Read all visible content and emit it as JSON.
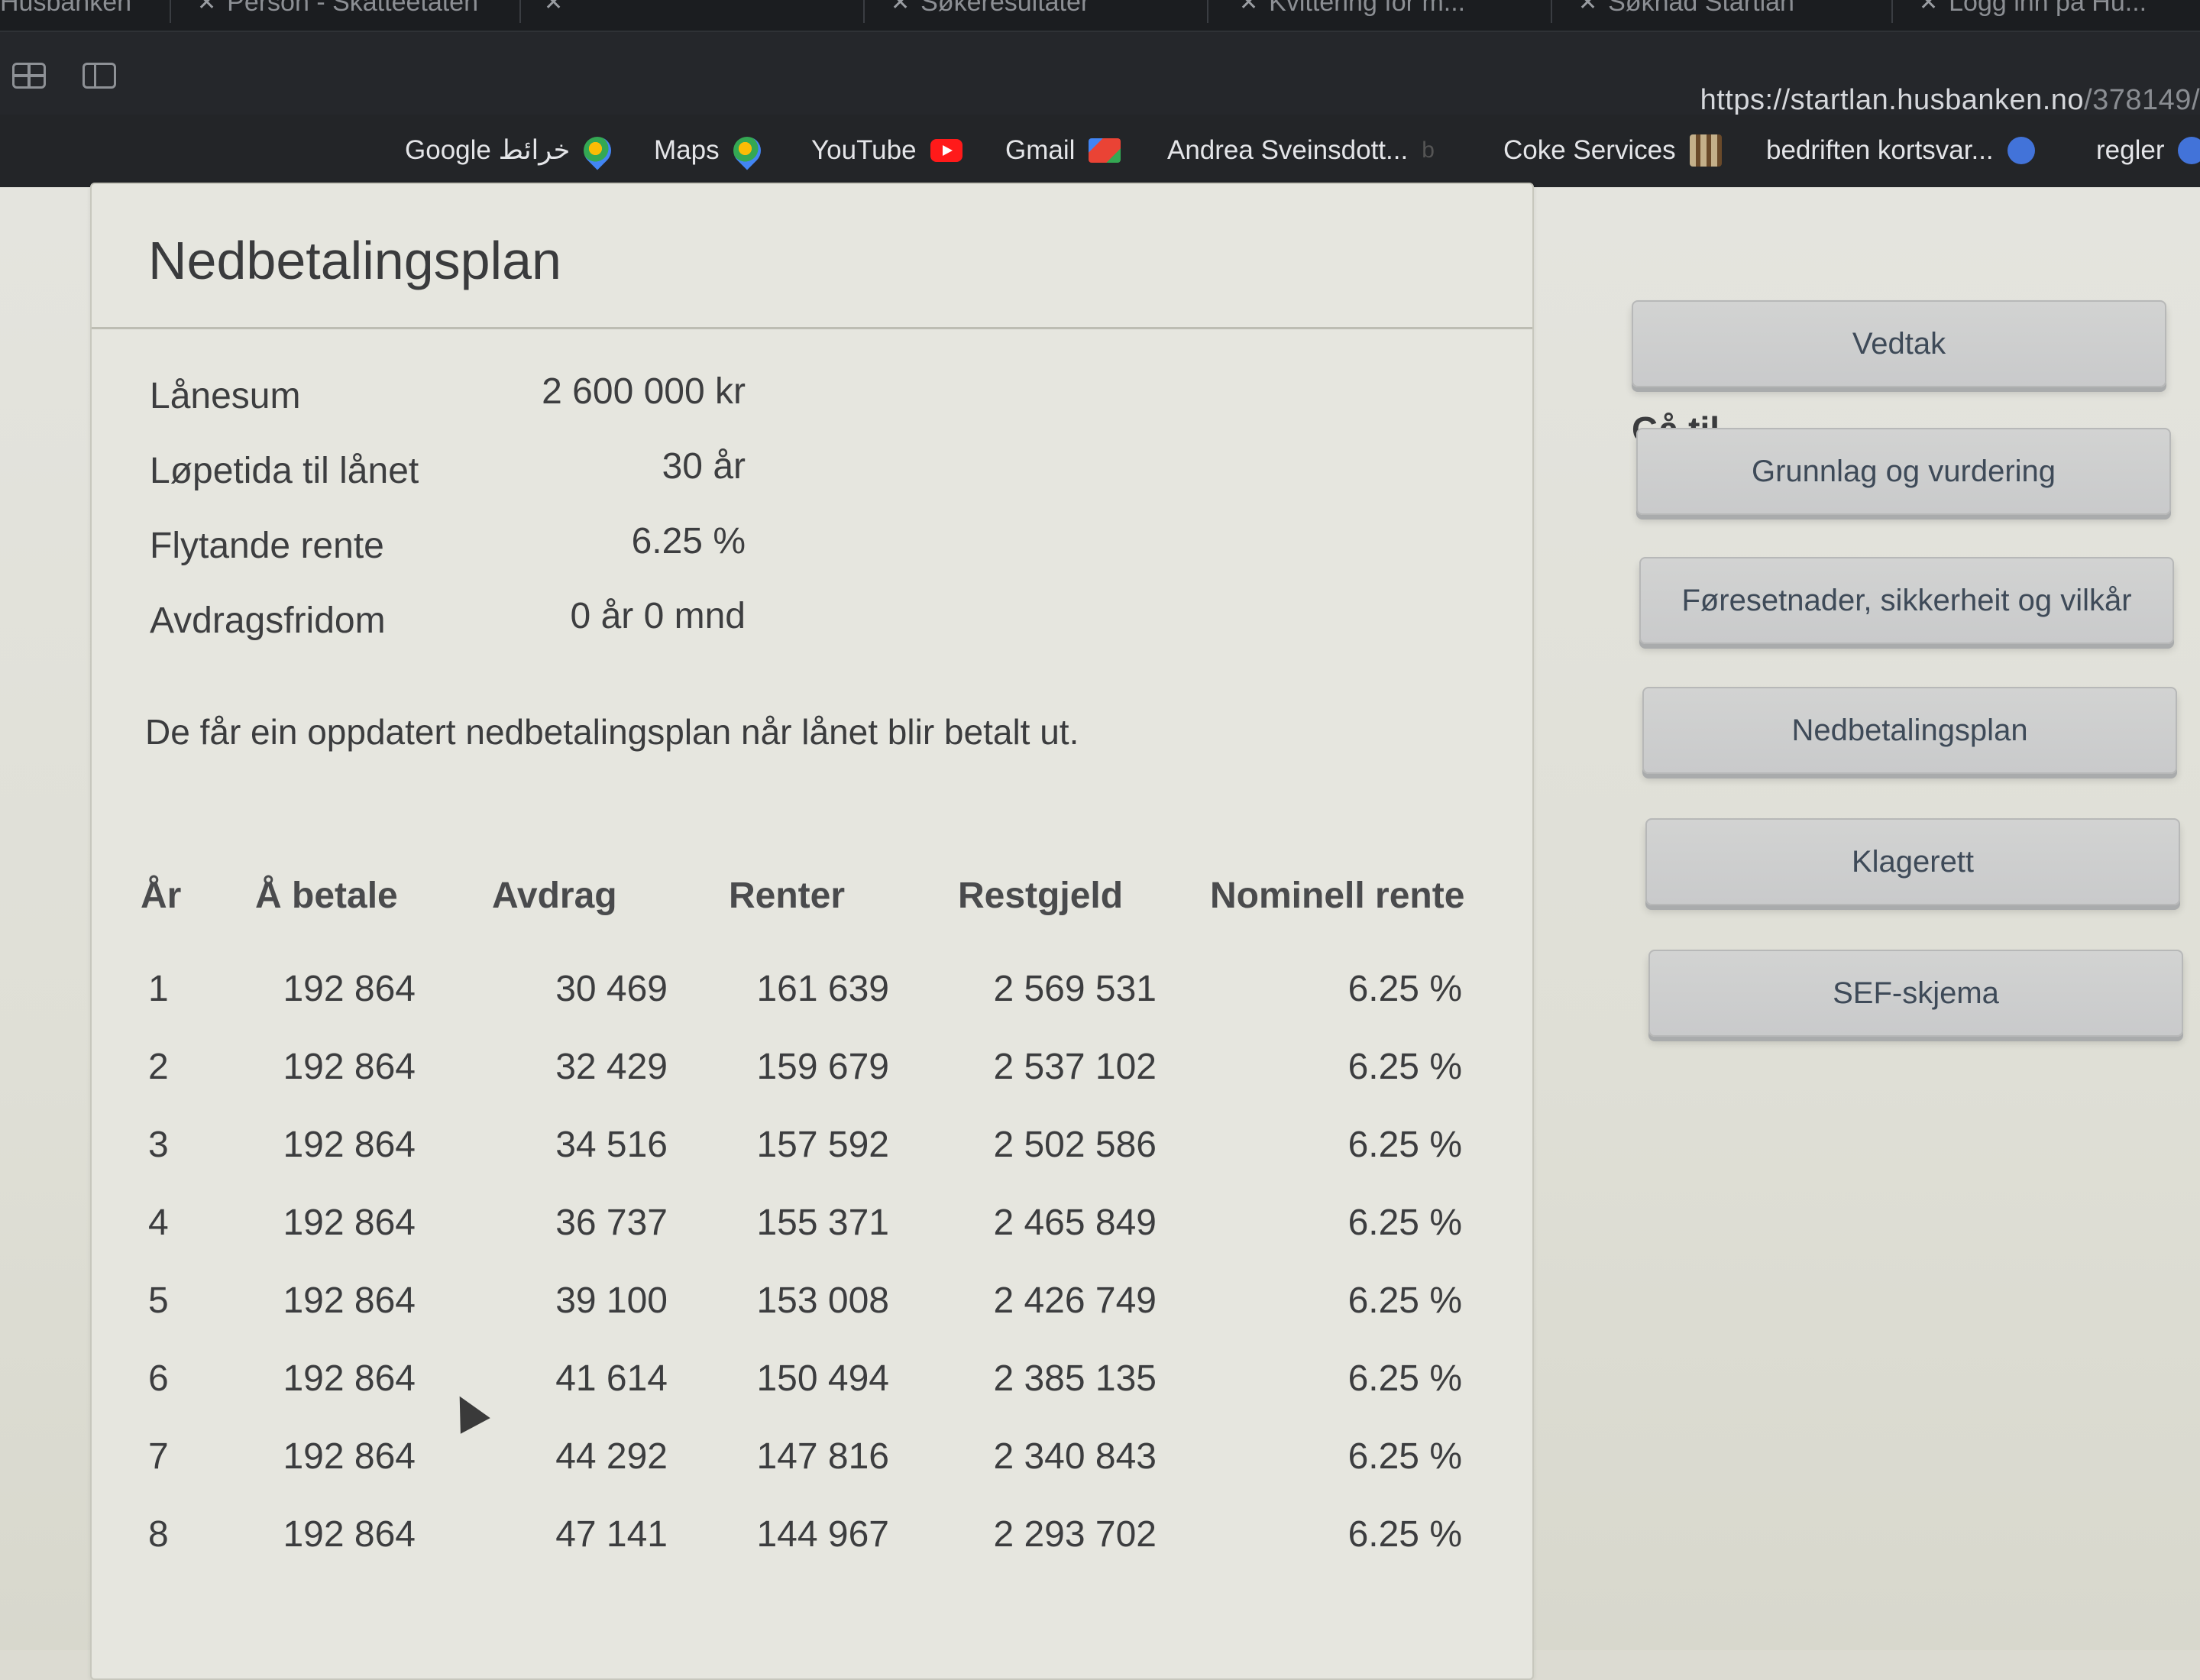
{
  "browser": {
    "tabs": [
      "Husbanken",
      "Person - Skatteetaten",
      "",
      "Søkeresultater",
      "Kvittering for m...",
      "Søknad Startlån",
      "Logg inn på Hu..."
    ],
    "url_main": "https://startlan.husbanken.no",
    "url_path": "/378149/",
    "bookmarks": [
      {
        "label": "Google خرائط",
        "icon": "maps-pin-icon"
      },
      {
        "label": "Maps",
        "icon": "maps-pin-icon"
      },
      {
        "label": "YouTube",
        "icon": "youtube-icon"
      },
      {
        "label": "Gmail",
        "icon": "gmail-icon"
      },
      {
        "label": "Andrea Sveinsdott...",
        "icon": "b-icon"
      },
      {
        "label": "Coke Services",
        "icon": "bt-icon"
      },
      {
        "label": "bedriften kortsvar...",
        "icon": "globe-icon"
      },
      {
        "label": "regler",
        "icon": "globe-icon"
      }
    ]
  },
  "card": {
    "title": "Nedbetalingsplan",
    "summary": [
      {
        "label": "Lånesum",
        "value": "2 600 000 kr"
      },
      {
        "label": "Løpetida til lånet",
        "value": "30 år"
      },
      {
        "label": "Flytande rente",
        "value": "6.25 %"
      },
      {
        "label": "Avdragsfridom",
        "value": "0 år 0 mnd"
      }
    ],
    "note": "De får ein oppdatert nedbetalingsplan når lånet blir betalt ut.",
    "table": {
      "headers": [
        "År",
        "Å betale",
        "Avdrag",
        "Renter",
        "Restgjeld",
        "Nominell rente"
      ],
      "rows": [
        [
          "1",
          "192 864",
          "30 469",
          "161 639",
          "2 569 531",
          "6.25 %"
        ],
        [
          "2",
          "192 864",
          "32 429",
          "159 679",
          "2 537 102",
          "6.25 %"
        ],
        [
          "3",
          "192 864",
          "34 516",
          "157 592",
          "2 502 586",
          "6.25 %"
        ],
        [
          "4",
          "192 864",
          "36 737",
          "155 371",
          "2 465 849",
          "6.25 %"
        ],
        [
          "5",
          "192 864",
          "39 100",
          "153 008",
          "2 426 749",
          "6.25 %"
        ],
        [
          "6",
          "192 864",
          "41 614",
          "150 494",
          "2 385 135",
          "6.25 %"
        ],
        [
          "7",
          "192 864",
          "44 292",
          "147 816",
          "2 340 843",
          "6.25 %"
        ],
        [
          "8",
          "192 864",
          "47 141",
          "144 967",
          "2 293 702",
          "6.25 %"
        ]
      ]
    }
  },
  "sidebar": {
    "title": "Gå til",
    "buttons": [
      "Vedtak",
      "Grunnlag og vurdering",
      "Føresetnader, sikkerheit og vilkår",
      "Nedbetalingsplan",
      "Klagerett",
      "SEF-skjema"
    ]
  }
}
